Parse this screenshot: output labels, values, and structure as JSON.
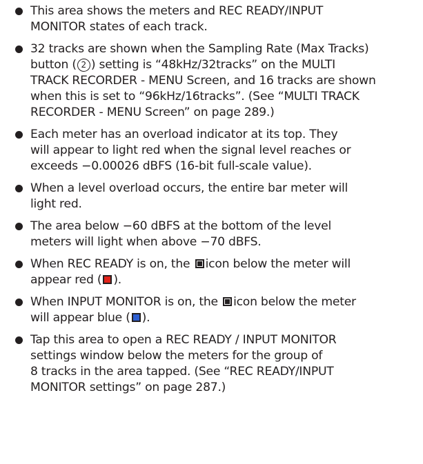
{
  "bullets": [
    {
      "lines": [
        "This area shows the meters and REC READY/INPUT",
        "MONITOR states of each track."
      ]
    },
    {
      "line1": "32 tracks are shown when the Sampling Rate (Max Tracks)",
      "line2_before": "button (",
      "circled": "2",
      "line2_after": ") setting is “48kHz/32tracks” on the MULTI",
      "lines_rest": [
        "TRACK RECORDER - MENU Screen, and 16 tracks are shown",
        "when this is set to “96kHz/16tracks”. (See “MULTI TRACK",
        "RECORDER - MENU Screen” on page 289.)"
      ]
    },
    {
      "lines": [
        "Each meter has an overload indicator at its top. They",
        "will appear to light red when the signal level reaches or",
        "exceeds −0.00026 dBFS (16-bit full-scale value)."
      ]
    },
    {
      "lines": [
        "When a level overload occurs, the entire bar meter will",
        "light red."
      ]
    },
    {
      "lines": [
        "The area below −60 dBFS at the bottom of the level",
        "meters will light when above −70 dBFS."
      ]
    },
    {
      "line1_before": "When REC READY is on, the",
      "line1_after": "icon below the meter will",
      "line2_before": "appear red (",
      "line2_after": ")."
    },
    {
      "line1_before": "When INPUT MONITOR is on, the",
      "line1_after": "icon below the meter",
      "line2_before": "will appear blue (",
      "line2_after": ")."
    },
    {
      "lines": [
        "Tap this area to open a REC READY / INPUT MONITOR",
        "settings window below the meters for the group of",
        "8 tracks in the area tapped. (See “REC READY/INPUT",
        "MONITOR settings” on page 287.)"
      ]
    }
  ],
  "icons": {
    "rec_ready_color": "#e2231a",
    "input_monitor_color": "#2e5fd1",
    "neutral_color": "#231f20"
  }
}
